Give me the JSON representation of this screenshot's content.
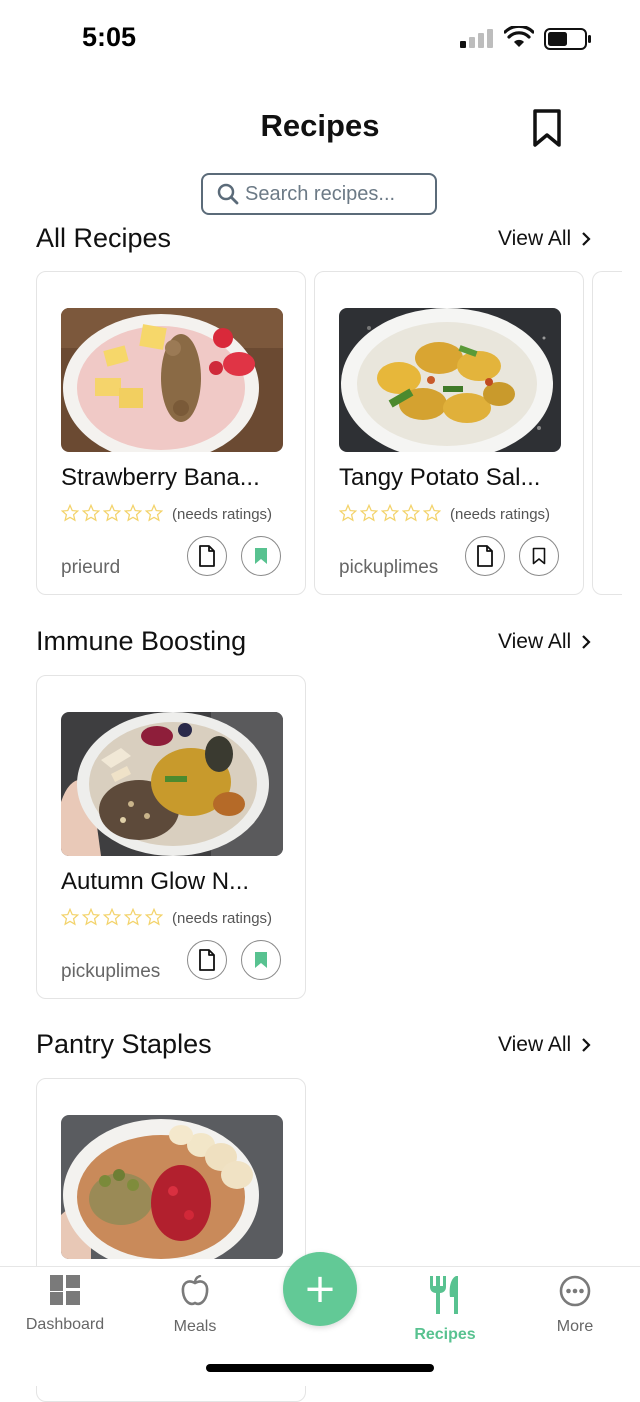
{
  "status": {
    "time": "5:05"
  },
  "header": {
    "title": "Recipes"
  },
  "search": {
    "placeholder": "Search recipes..."
  },
  "colors": {
    "accent": "#58c290",
    "fab": "#62c996",
    "star": "#f3d36b"
  },
  "sections": [
    {
      "title": "All Recipes",
      "view_all": "View All",
      "cards": [
        {
          "name": "Strawberry Bana...",
          "ratings": "(needs ratings)",
          "author": "prieurd",
          "saved": true,
          "rating": 0
        },
        {
          "name": "Tangy Potato Sal...",
          "ratings": "(needs ratings)",
          "author": "pickuplimes",
          "saved": false,
          "rating": 0
        }
      ]
    },
    {
      "title": "Immune Boosting",
      "view_all": "View All",
      "cards": [
        {
          "name": "Autumn Glow N...",
          "ratings": "(needs ratings)",
          "author": "pickuplimes",
          "saved": true,
          "rating": 0
        }
      ]
    },
    {
      "title": "Pantry Staples",
      "view_all": "View All",
      "cards": []
    }
  ],
  "tabbar": {
    "items": [
      {
        "label": "Dashboard",
        "icon": "dashboard-icon"
      },
      {
        "label": "Meals",
        "icon": "apple-icon"
      },
      {
        "label": "Recipes",
        "icon": "fork-knife-icon"
      },
      {
        "label": "More",
        "icon": "more-icon"
      }
    ],
    "fab_label": "+"
  }
}
